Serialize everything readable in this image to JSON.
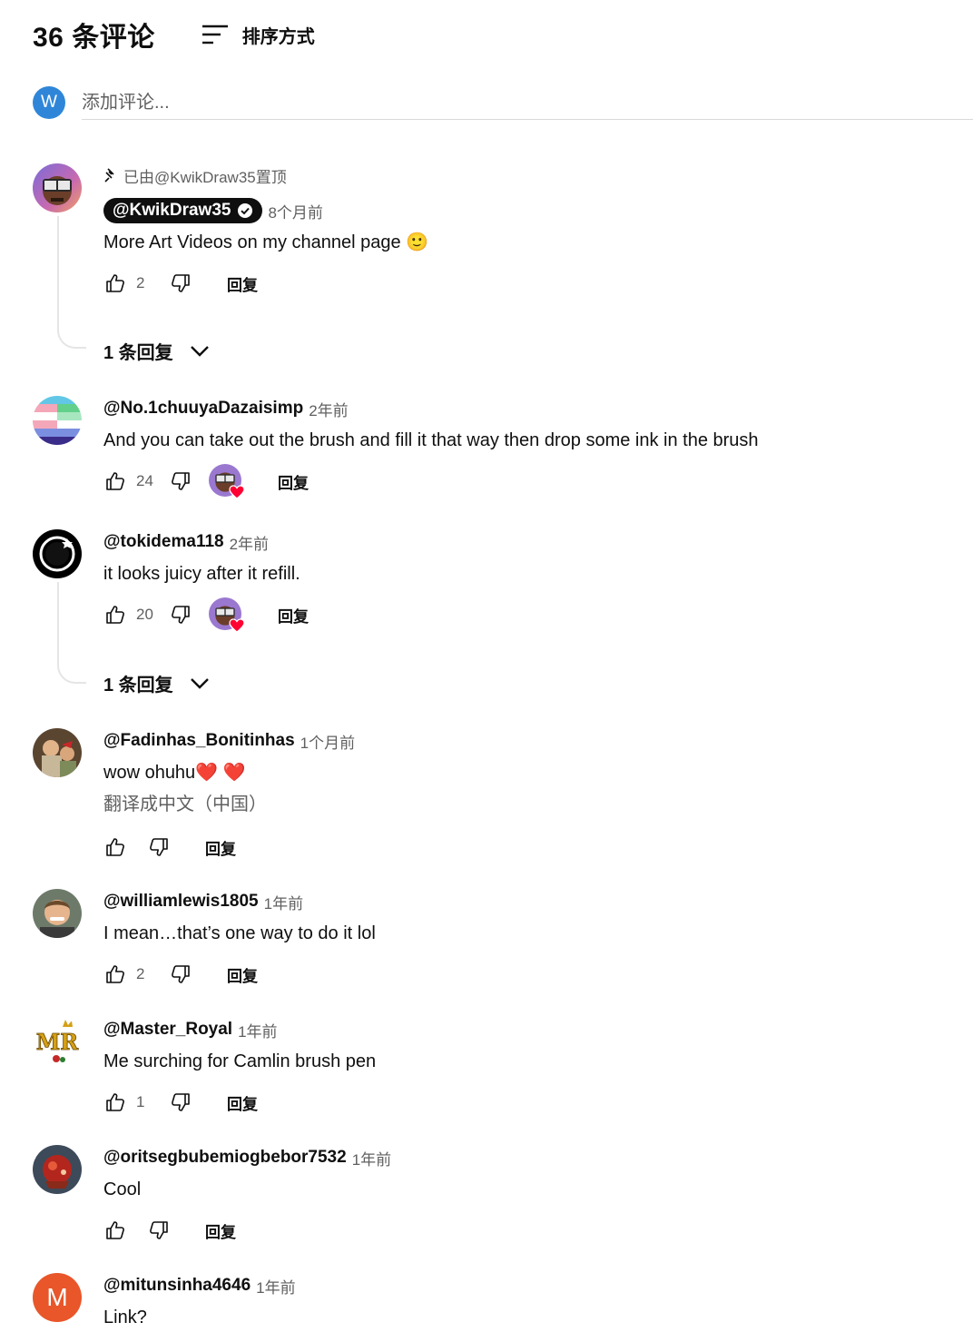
{
  "header": {
    "count_label": "36 条评论",
    "sort_label": "排序方式"
  },
  "composer": {
    "avatar_letter": "W",
    "placeholder": "添加评论..."
  },
  "comments": [
    {
      "pinned_text": "已由@KwikDraw35置顶",
      "author": "@KwikDraw35",
      "time": "8个月前",
      "text": "More Art Videos on my channel page 🙂",
      "likes": "2",
      "reply_label": "回复",
      "replies_label": "1 条回复"
    },
    {
      "author": "@No.1chuuyaDazaisimp",
      "time": "2年前",
      "text": "And you can take out the brush and fill it that way then drop some ink in the brush",
      "likes": "24",
      "reply_label": "回复"
    },
    {
      "author": "@tokidema118",
      "time": "2年前",
      "text": "it looks juicy after it refill.",
      "likes": "20",
      "reply_label": "回复",
      "replies_label": "1 条回复"
    },
    {
      "author": "@Fadinhas_Bonitinhas",
      "time": "1个月前",
      "text": "wow ohuhu❤️ ❤️",
      "translate": "翻译成中文（中国）",
      "likes": "",
      "reply_label": "回复"
    },
    {
      "author": "@williamlewis1805",
      "time": "1年前",
      "text": "I mean…that’s one way to do it lol",
      "likes": "2",
      "reply_label": "回复"
    },
    {
      "author": "@Master_Royal",
      "time": "1年前",
      "text": "Me surching for Camlin brush pen",
      "likes": "1",
      "reply_label": "回复",
      "avatar_text": "MR"
    },
    {
      "author": "@oritsegbubemiogbebor7532",
      "time": "1年前",
      "text": "Cool",
      "likes": "",
      "reply_label": "回复"
    },
    {
      "author": "@mitunsinha4646",
      "time": "1年前",
      "text": "Link?",
      "avatar_letter": "M"
    }
  ],
  "colors": {
    "heart": "#ff0033",
    "avatar_blue": "#2f86d8",
    "avatar_orange": "#e8562a"
  }
}
